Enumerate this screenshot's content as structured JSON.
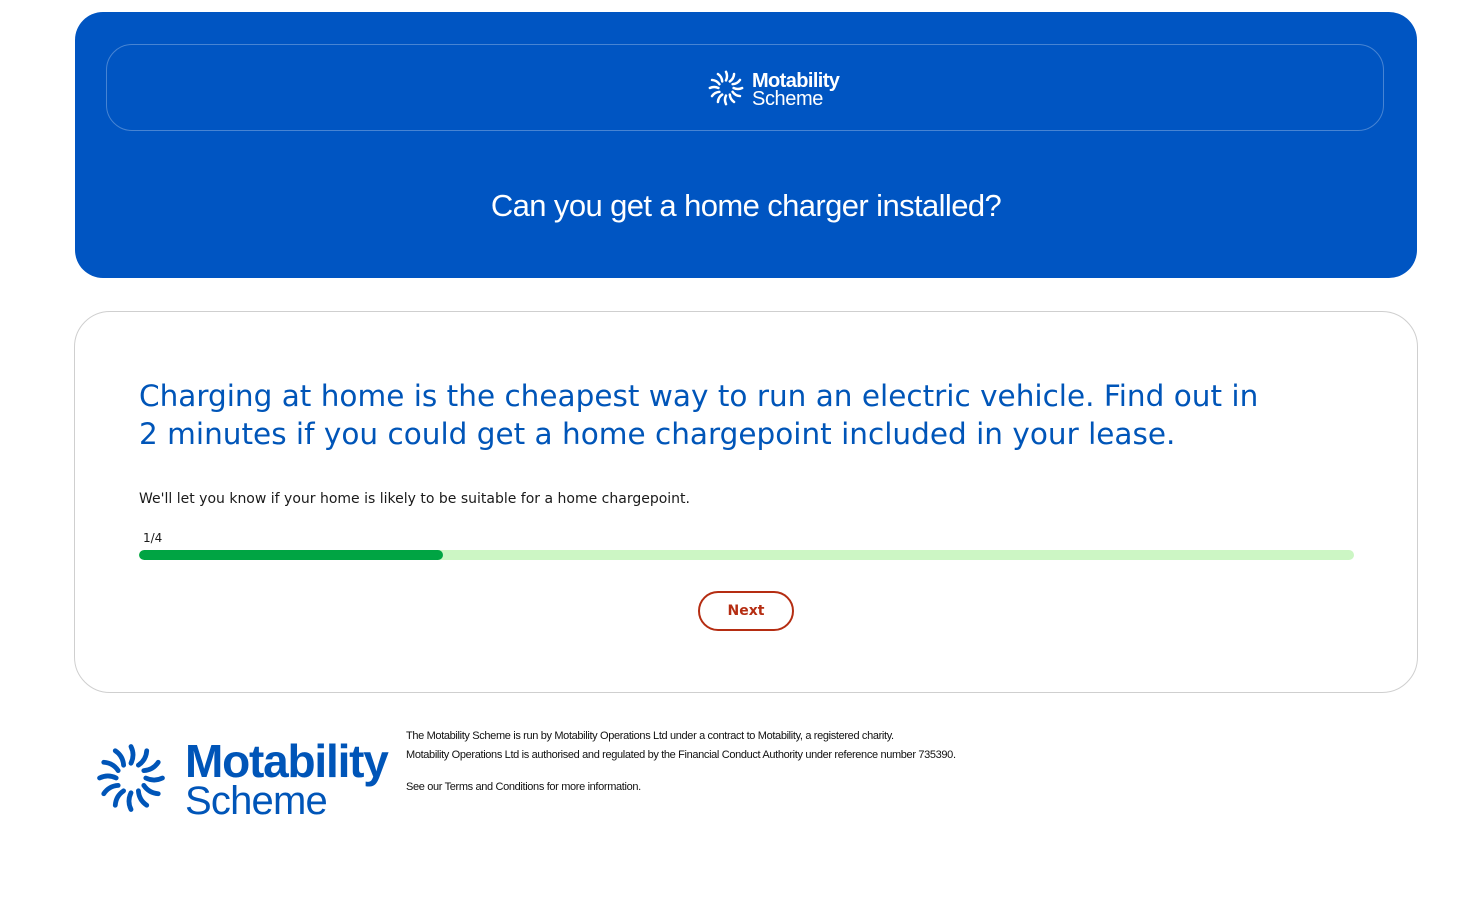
{
  "brand": {
    "name_line1": "Motability",
    "name_line2": "Scheme",
    "logo_icon": "starburst-icon",
    "primary_color": "#0055c2",
    "heading_color": "#0055b8",
    "cta_color": "#b52d12",
    "progress_color": "#00a443",
    "progress_track_color": "#ccf6c4"
  },
  "hero": {
    "title": "Can you get a home charger installed?"
  },
  "card": {
    "heading": "Charging at home is the cheapest way to run an electric vehicle. Find out in 2 minutes if you could get a home chargepoint included in your lease.",
    "subtext": "We'll let you know if your home is likely to be suitable for a home chargepoint.",
    "progress": {
      "label": "1/4",
      "fraction": 0.25
    },
    "next_label": "Next"
  },
  "footer": {
    "line1": "The Motability Scheme is run by Motability Operations Ltd under a contract to Motability, a registered charity.",
    "line2": "Motability Operations Ltd is authorised and regulated by the Financial Conduct Authority under reference number 735390.",
    "line3_prefix": "See our",
    "terms_link": "Terms and Conditions",
    "line3_suffix": "for more information."
  }
}
